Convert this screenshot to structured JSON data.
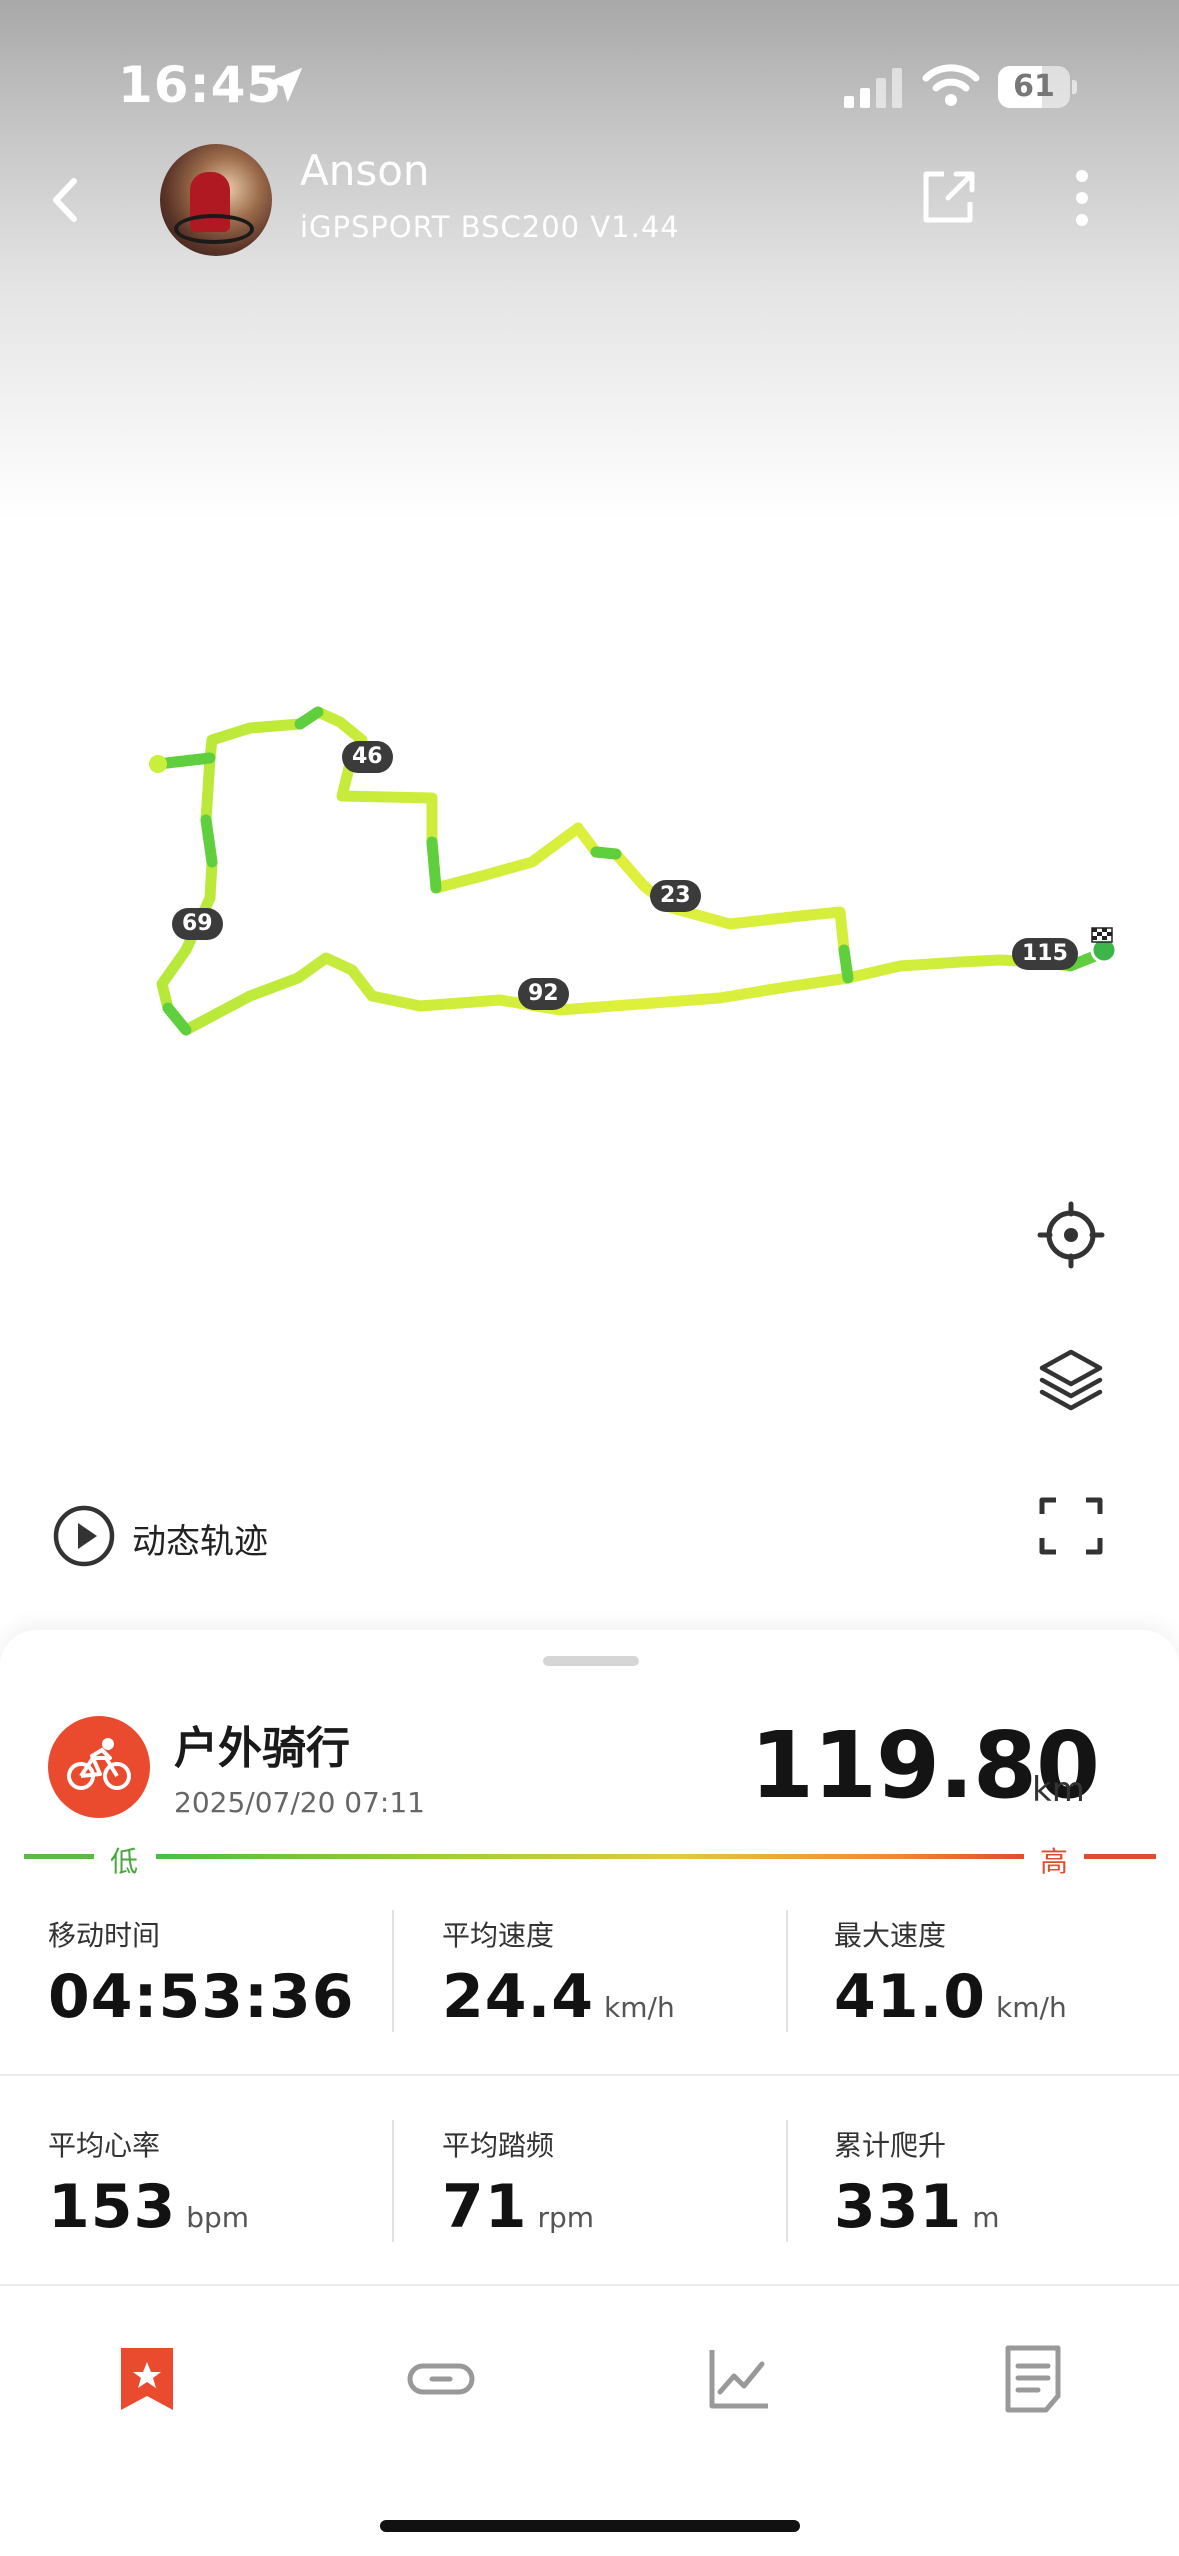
{
  "status_bar": {
    "time": "16:45",
    "battery": "61",
    "battery_level": 0.61
  },
  "header": {
    "user_name": "Anson",
    "device": "iGPSPORT BSC200 V1.44",
    "icons": [
      "chevron-left-icon",
      "share-icon",
      "more-vertical-icon"
    ]
  },
  "map": {
    "km_markers": [
      "46",
      "69",
      "23",
      "92",
      "115"
    ],
    "route_colors": {
      "low": "#4cbb4a",
      "mid": "#d7ee3c",
      "high": "#e24b32"
    },
    "playback_label": "动态轨迹",
    "controls": [
      "locate-icon",
      "layers-icon",
      "fullscreen-icon"
    ]
  },
  "summary": {
    "activity_type": "户外骑行",
    "date": "2025/07/20 07:11",
    "distance": "119.80",
    "distance_unit": "km",
    "scale_low": "低",
    "scale_high": "高",
    "accent_color": "#ea4a2e"
  },
  "stats": [
    {
      "label": "移动时间",
      "value": "04:53:36",
      "unit": ""
    },
    {
      "label": "平均速度",
      "value": "24.4",
      "unit": "km/h"
    },
    {
      "label": "最大速度",
      "value": "41.0",
      "unit": "km/h"
    },
    {
      "label": "平均心率",
      "value": "153",
      "unit": "bpm"
    },
    {
      "label": "平均踏频",
      "value": "71",
      "unit": "rpm"
    },
    {
      "label": "累计爬升",
      "value": "331",
      "unit": "m"
    }
  ],
  "bottom_nav": {
    "items": [
      "star-bookmark-icon",
      "link-icon",
      "chart-line-icon",
      "document-icon"
    ],
    "active_index": 0
  }
}
